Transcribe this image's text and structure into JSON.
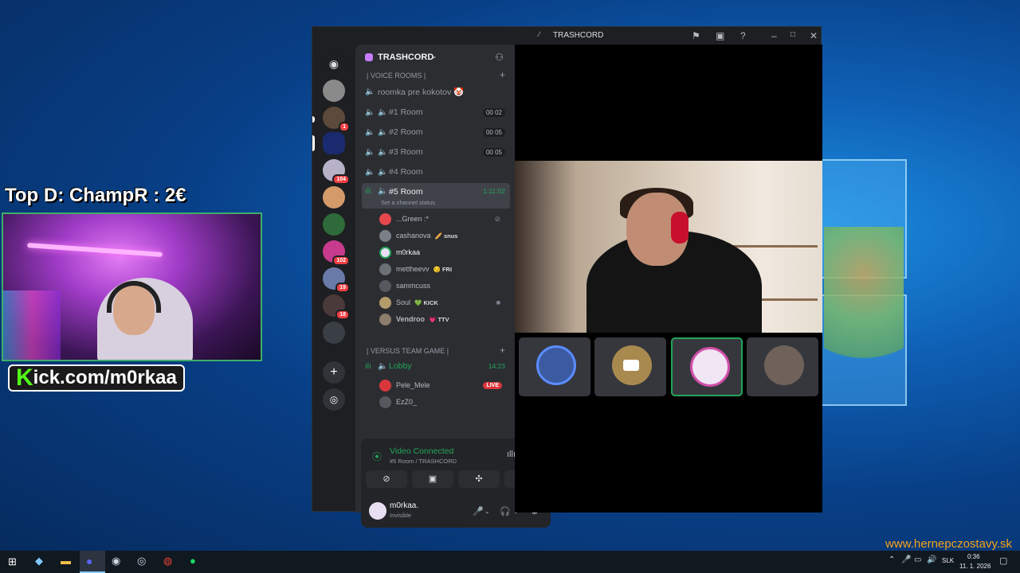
{
  "overlay": {
    "top_donor": "Top D: ChampR : 2€",
    "kick_prefix": "K",
    "kick_rest": "ick.com/m0rkaa",
    "watermark": "www.hernepczostavy.sk"
  },
  "window": {
    "title": "TRASHCORD",
    "icons": [
      "discord-logo-icon",
      "inbox-flag-icon",
      "inbox-icon",
      "help-icon",
      "minimize-icon",
      "maximize-icon",
      "close-icon"
    ]
  },
  "guilds": {
    "badges": [
      "1",
      "104",
      "102",
      "19",
      "18"
    ]
  },
  "server": {
    "name": "TRASHCORD",
    "categories": {
      "voice_rooms": "| VOICE ROOMS |",
      "versus": "| VERSUS TEAM GAME |"
    },
    "channels": [
      {
        "label": "roomka pre kokotov 🤡",
        "count": ""
      },
      {
        "label": "#1 Room",
        "count": "00 02"
      },
      {
        "label": "#2 Room",
        "count": "00 05"
      },
      {
        "label": "#3 Room",
        "count": "00 05"
      },
      {
        "label": "#4 Room",
        "count": ""
      },
      {
        "label": "#5 Room",
        "time": "1:11:02",
        "status": "Set a channel status"
      },
      {
        "label": "Lobby",
        "time": "14:23"
      }
    ],
    "room5_members": [
      {
        "name": "...Green :*",
        "tag": "",
        "color": "#e5484d"
      },
      {
        "name": "cashanova",
        "tag": "🥖 snus",
        "color": "#9aa0a6"
      },
      {
        "name": "m0rkaa",
        "tag": "",
        "color": "#ffffff"
      },
      {
        "name": "mettheevv",
        "tag": "😏 FRI",
        "color": "#9aa0a6"
      },
      {
        "name": "sammcuss",
        "tag": "",
        "color": "#9aa0a6"
      },
      {
        "name": "Soul",
        "tag": "💚 KICK",
        "color": "#9aa0a6"
      },
      {
        "name": "Vendroo",
        "tag": "💗 TTV",
        "color": "#9aa0a6"
      }
    ],
    "lobby_members": [
      {
        "name": "Pele_Mele",
        "badge": "LIVE"
      },
      {
        "name": "EzZ0_",
        "badge": ""
      }
    ]
  },
  "voice": {
    "status": "Video Connected",
    "location": "#5 Room / TRASHCORD"
  },
  "user": {
    "name": "m0rkaa.",
    "status": "Invisible"
  },
  "taskbar": {
    "language": "SLK",
    "time": "0:36",
    "date": "11. 1. 2026"
  }
}
